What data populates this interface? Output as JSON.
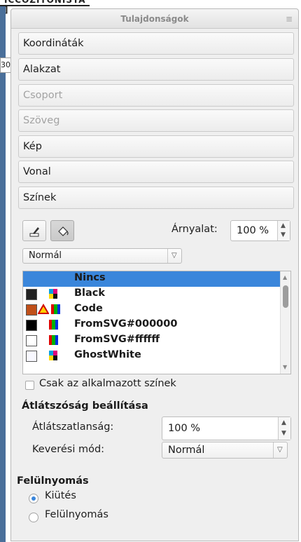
{
  "background": {
    "text": "ICCOZITONISTA ]",
    "left_fragment": "30"
  },
  "panel": {
    "title": "Tulajdonságok",
    "close_glyph": "≡"
  },
  "sections": [
    {
      "label": "Koordináták",
      "enabled": true
    },
    {
      "label": "Alakzat",
      "enabled": true
    },
    {
      "label": "Csoport",
      "enabled": false
    },
    {
      "label": "Szöveg",
      "enabled": false
    },
    {
      "label": "Kép",
      "enabled": true
    },
    {
      "label": "Vonal",
      "enabled": true
    },
    {
      "label": "Színek",
      "enabled": true
    }
  ],
  "colors": {
    "tools": [
      {
        "name": "edit-line-color-icon",
        "active": false
      },
      {
        "name": "fill-color-icon",
        "active": true
      }
    ],
    "shade_label": "Árnyalat:",
    "shade_value": "100 %",
    "mode_select": "Normál",
    "list": [
      {
        "name": "Nincs",
        "swatch": null,
        "selected": true
      },
      {
        "name": "Black",
        "swatch": "#222222",
        "selected": false
      },
      {
        "name": "Code",
        "swatch": "#c0501a",
        "warning": true,
        "selected": false
      },
      {
        "name": "FromSVG#000000",
        "swatch": "#000000",
        "selected": false
      },
      {
        "name": "FromSVG#ffffff",
        "swatch": "#ffffff",
        "selected": false
      },
      {
        "name": "GhostWhite",
        "swatch": "#f8f8ff",
        "selected": false
      }
    ],
    "only_used_label": "Csak az alkalmazott színek",
    "transparency_heading": "Átlátszóság beállítása",
    "opacity_label": "Átlátszatlanság:",
    "opacity_value": "100 %",
    "blend_label": "Keverési mód:",
    "blend_value": "Normál",
    "overprint_heading": "Felülnyomás",
    "overprint_options": [
      {
        "label": "Kiütés",
        "checked": true
      },
      {
        "label": "Felülnyomás",
        "checked": false
      }
    ]
  },
  "accent": "#3a86db"
}
